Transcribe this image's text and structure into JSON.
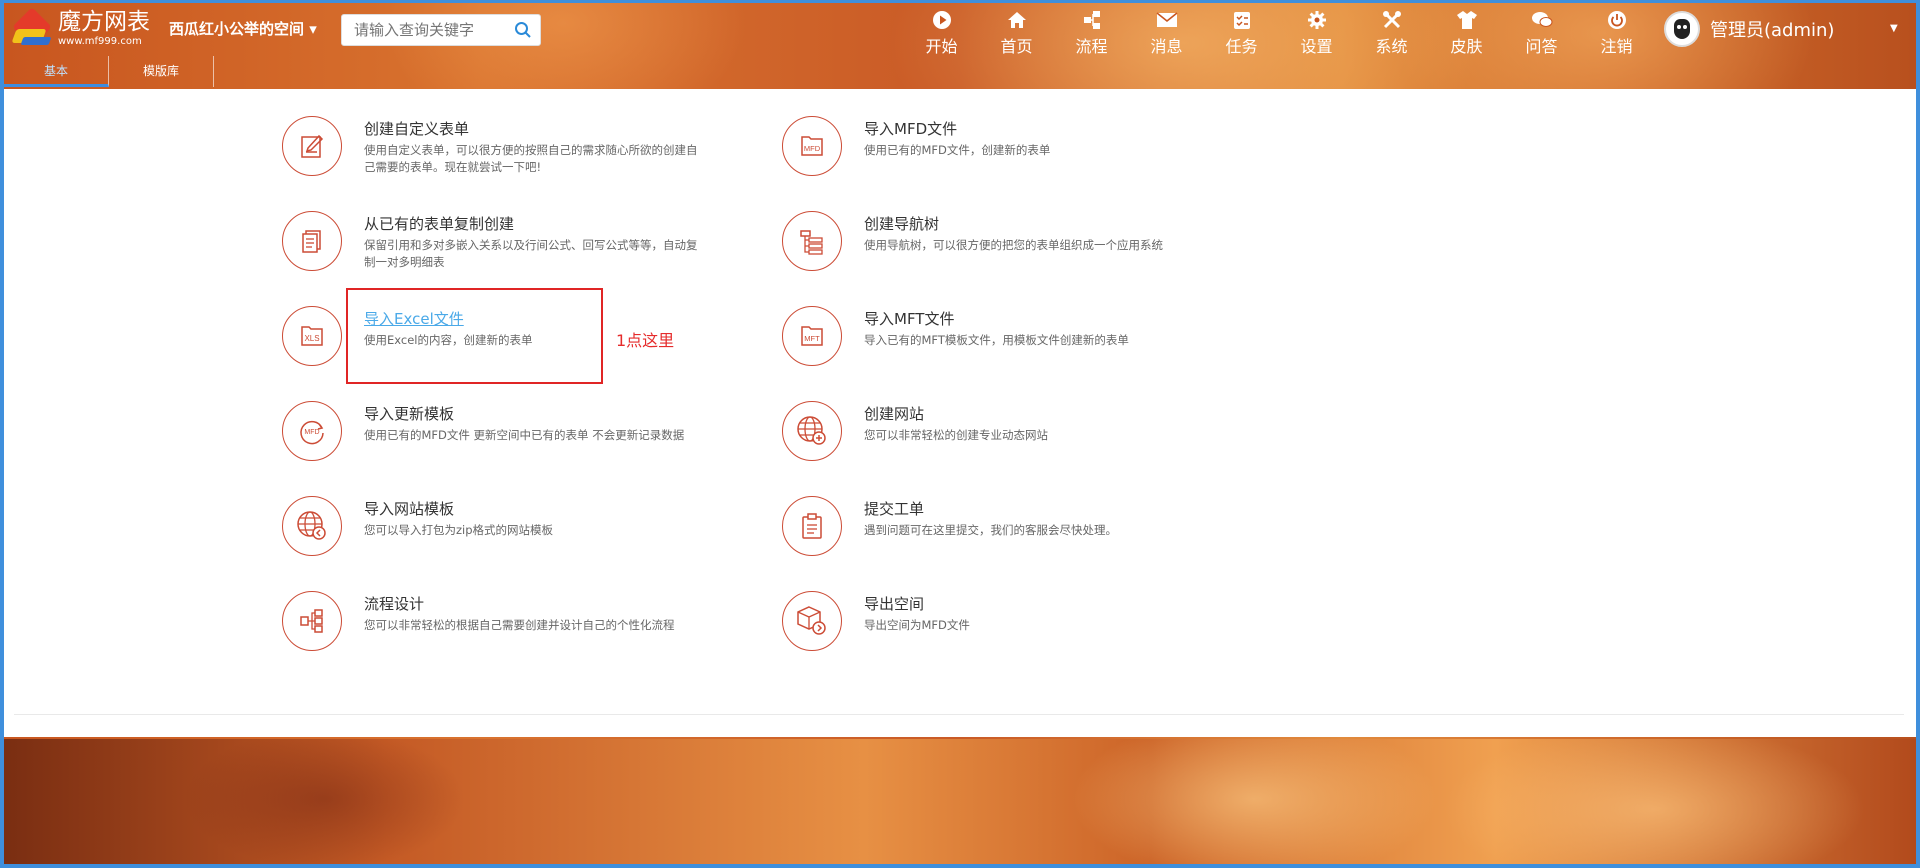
{
  "app": {
    "logo_title": "魔方网表",
    "logo_url": "www.mf999.com",
    "space": "西瓜红小公举的空间 ▾"
  },
  "search": {
    "placeholder": "请输入查询关键字"
  },
  "nav": [
    {
      "label": "开始",
      "icon": "play-icon"
    },
    {
      "label": "首页",
      "icon": "home-icon"
    },
    {
      "label": "流程",
      "icon": "flow-icon"
    },
    {
      "label": "消息",
      "icon": "mail-icon"
    },
    {
      "label": "任务",
      "icon": "task-icon"
    },
    {
      "label": "设置",
      "icon": "gear-icon"
    },
    {
      "label": "系统",
      "icon": "tools-icon"
    },
    {
      "label": "皮肤",
      "icon": "shirt-icon"
    },
    {
      "label": "问答",
      "icon": "chat-icon"
    },
    {
      "label": "注销",
      "icon": "power-icon"
    }
  ],
  "user": {
    "name": "管理员(admin)"
  },
  "tabs": [
    {
      "label": "基本"
    },
    {
      "label": "模版库"
    }
  ],
  "items": [
    {
      "title": "创建自定义表单",
      "desc": "使用自定义表单，可以很方便的按照自己的需求随心所欲的创建自己需要的表单。现在就尝试一下吧!",
      "icon": "form-edit-icon"
    },
    {
      "title": "导入MFD文件",
      "desc": "使用已有的MFD文件，创建新的表单",
      "icon": "mfd-file-icon"
    },
    {
      "title": "从已有的表单复制创建",
      "desc": "保留引用和多对多嵌入关系以及行间公式、回写公式等等，自动复制一对多明细表",
      "icon": "copy-form-icon"
    },
    {
      "title": "创建导航树",
      "desc": "使用导航树，可以很方便的把您的表单组织成一个应用系统",
      "icon": "nav-tree-icon"
    },
    {
      "title": "导入Excel文件",
      "desc": "使用Excel的内容，创建新的表单",
      "icon": "xls-file-icon"
    },
    {
      "title": "导入MFT文件",
      "desc": "导入已有的MFT模板文件，用模板文件创建新的表单",
      "icon": "mft-file-icon"
    },
    {
      "title": "导入更新模板",
      "desc": "使用已有的MFD文件 更新空间中已有的表单 不会更新记录数据",
      "icon": "mfd-refresh-icon"
    },
    {
      "title": "创建网站",
      "desc": "您可以非常轻松的创建专业动态网站",
      "icon": "globe-plus-icon"
    },
    {
      "title": "导入网站模板",
      "desc": "您可以导入打包为zip格式的网站模板",
      "icon": "globe-import-icon"
    },
    {
      "title": "提交工单",
      "desc": "遇到问题可在这里提交，我们的客服会尽快处理。",
      "icon": "clipboard-icon"
    },
    {
      "title": "流程设计",
      "desc": "您可以非常轻松的根据自己需要创建并设计自己的个性化流程",
      "icon": "flow-design-icon"
    },
    {
      "title": "导出空间",
      "desc": "导出空间为MFD文件",
      "icon": "box-export-icon"
    }
  ],
  "annotation": {
    "note": "1点这里"
  },
  "colors": {
    "accent": "#cc4c36",
    "link": "#4aa9e8",
    "highlight": "#e02525",
    "frame": "#3f8fdc"
  }
}
